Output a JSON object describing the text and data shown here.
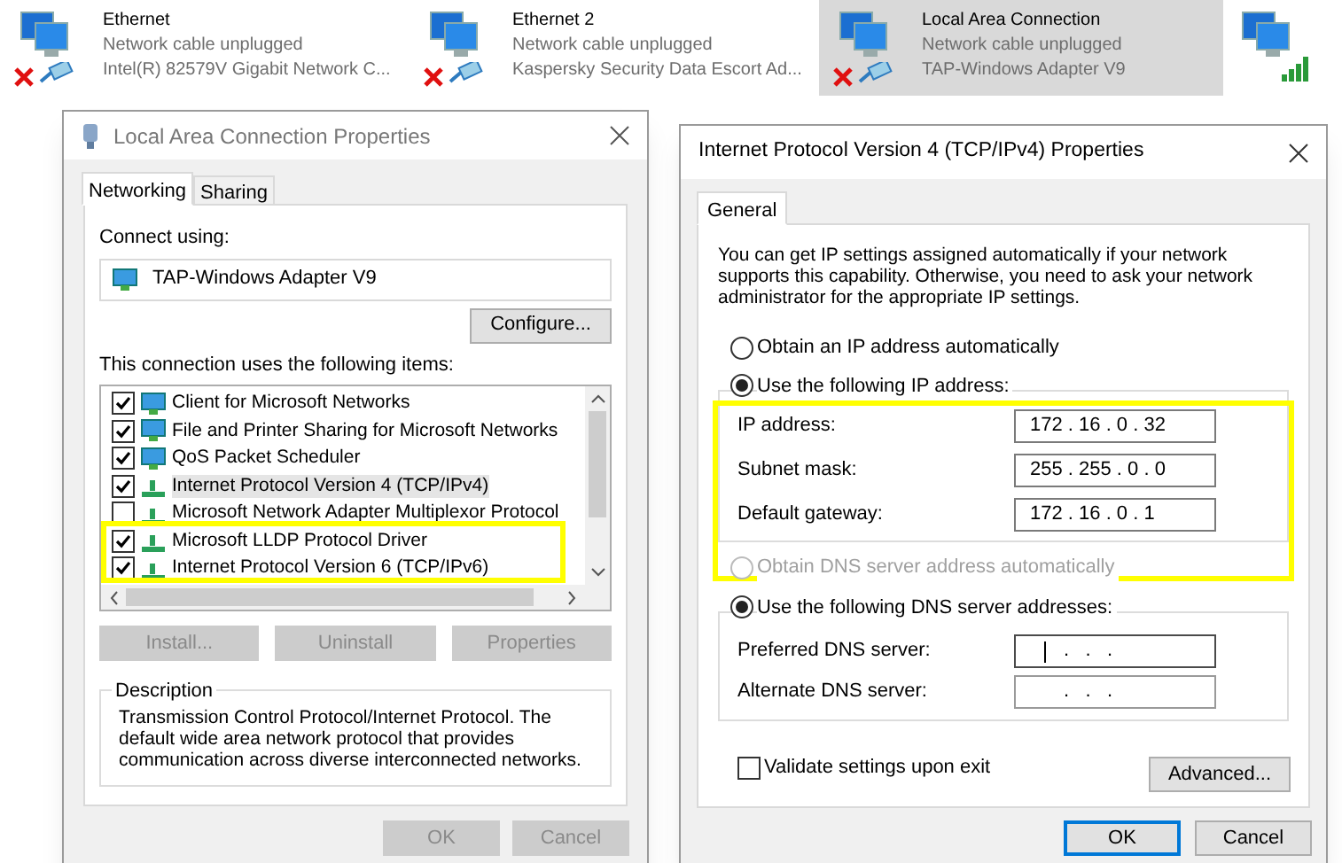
{
  "adapters": [
    {
      "name": "Ethernet",
      "status": "Network cable unplugged",
      "device": "Intel(R) 82579V Gigabit Network C...",
      "selected": false
    },
    {
      "name": "Ethernet 2",
      "status": "Network cable unplugged",
      "device": "Kaspersky Security Data Escort Ad...",
      "selected": false
    },
    {
      "name": "Local Area Connection",
      "status": "Network cable unplugged",
      "device": "TAP-Windows Adapter V9",
      "selected": true
    }
  ],
  "lan_dialog": {
    "title": "Local Area Connection Properties",
    "tabs": [
      {
        "label": "Networking",
        "selected": true
      },
      {
        "label": "Sharing",
        "selected": false
      }
    ],
    "connect_using_label": "Connect using:",
    "adapter": "TAP-Windows Adapter V9",
    "configure_button": "Configure...",
    "items_label": "This connection uses the following items:",
    "items": [
      {
        "label": "Client for Microsoft Networks",
        "checked": true,
        "kind": "service",
        "selected": false
      },
      {
        "label": "File and Printer Sharing for Microsoft Networks",
        "checked": true,
        "kind": "service",
        "selected": false
      },
      {
        "label": "QoS Packet Scheduler",
        "checked": true,
        "kind": "service",
        "selected": false
      },
      {
        "label": "Internet Protocol Version 4 (TCP/IPv4)",
        "checked": true,
        "kind": "protocol",
        "selected": true
      },
      {
        "label": "Microsoft Network Adapter Multiplexor Protocol",
        "checked": false,
        "kind": "protocol",
        "selected": false
      },
      {
        "label": "Microsoft LLDP Protocol Driver",
        "checked": true,
        "kind": "protocol",
        "selected": false
      },
      {
        "label": "Internet Protocol Version 6 (TCP/IPv6)",
        "checked": true,
        "kind": "protocol",
        "selected": false
      }
    ],
    "buttons": [
      {
        "label": "Install...",
        "disabled": true
      },
      {
        "label": "Uninstall",
        "disabled": true
      },
      {
        "label": "Properties",
        "disabled": true
      }
    ],
    "description_title": "Description",
    "description": "Transmission Control Protocol/Internet Protocol. The default wide area network protocol that provides communication across diverse interconnected networks.",
    "footer_buttons": [
      {
        "label": "OK",
        "disabled": true
      },
      {
        "label": "Cancel",
        "disabled": true
      }
    ]
  },
  "ipv4_dialog": {
    "title": "Internet Protocol Version 4 (TCP/IPv4) Properties",
    "tabs": [
      {
        "label": "General",
        "selected": true
      }
    ],
    "intro": "You can get IP settings assigned automatically if your network supports this capability. Otherwise, you need to ask your network administrator for the appropriate IP settings.",
    "ip_options": [
      {
        "label": "Obtain an IP address automatically",
        "selected": false,
        "disabled": false
      },
      {
        "label": "Use the following IP address:",
        "selected": true,
        "disabled": false
      }
    ],
    "ip_fields": [
      {
        "label": "IP address:",
        "value": "172 . 16 . 0 . 32"
      },
      {
        "label": "Subnet mask:",
        "value": "255 . 255 . 0 . 0"
      },
      {
        "label": "Default gateway:",
        "value": "172 . 16 . 0 . 1"
      }
    ],
    "dns_options": [
      {
        "label": "Obtain DNS server address automatically",
        "selected": false,
        "disabled": true
      },
      {
        "label": "Use the following DNS server addresses:",
        "selected": true,
        "disabled": false
      }
    ],
    "dns_fields": [
      {
        "label": "Preferred DNS server:",
        "value": ".   .   .",
        "focused": true
      },
      {
        "label": "Alternate DNS server:",
        "value": ".   .   .",
        "focused": false
      }
    ],
    "validate": {
      "label": "Validate settings upon exit",
      "checked": false
    },
    "advanced_button": "Advanced...",
    "footer_buttons": [
      {
        "label": "OK",
        "default": true
      },
      {
        "label": "Cancel",
        "default": false
      }
    ]
  }
}
